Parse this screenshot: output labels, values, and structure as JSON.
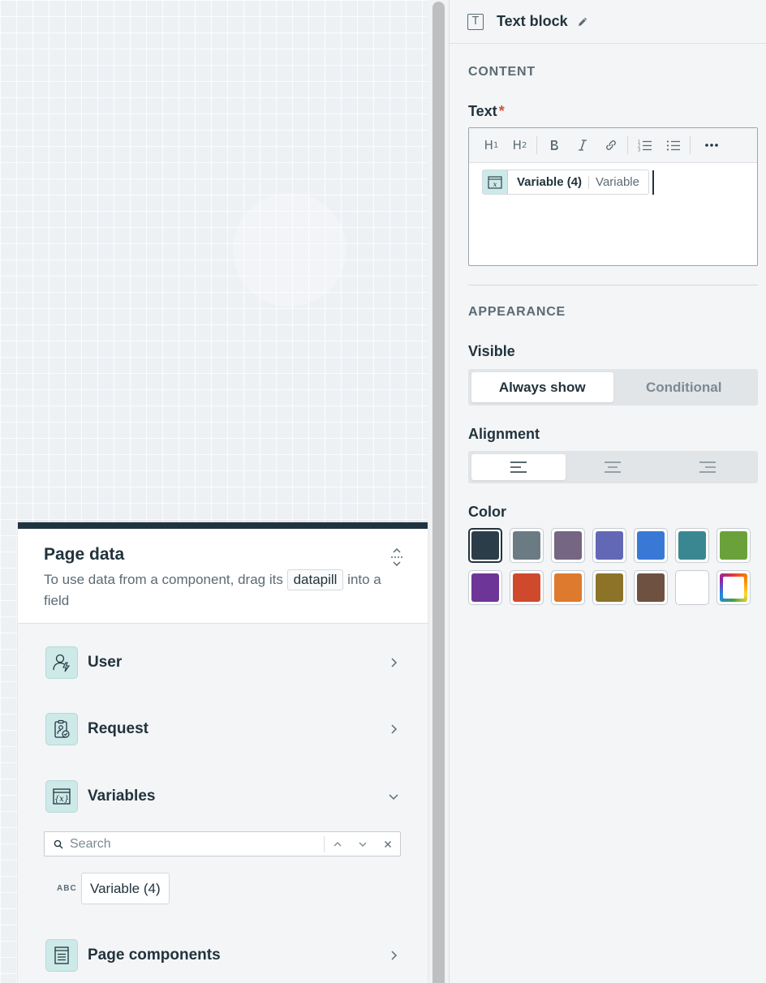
{
  "canvas": {},
  "page_data": {
    "title": "Page data",
    "description_before": "To use data from a component, drag its",
    "description_pill": "datapill",
    "description_after": "into a field",
    "sections": [
      {
        "label": "User",
        "icon": "user-icon",
        "expanded": false
      },
      {
        "label": "Request",
        "icon": "request-icon",
        "expanded": false
      },
      {
        "label": "Variables",
        "icon": "variables-icon",
        "expanded": true
      },
      {
        "label": "Page components",
        "icon": "page-components-icon",
        "expanded": false
      }
    ],
    "search": {
      "placeholder": "Search",
      "value": ""
    },
    "variables": [
      {
        "type_tag": "ABC",
        "name": "Variable (4)"
      }
    ]
  },
  "properties": {
    "title": "Text block",
    "content_heading": "CONTENT",
    "text_label": "Text",
    "required_mark": "*",
    "toolbar": [
      "H1",
      "H2",
      "bold",
      "italic",
      "link",
      "ordered-list",
      "bulleted-list",
      "more"
    ],
    "editor": {
      "datapill_label": "Variable (4)",
      "datapill_type": "Variable"
    },
    "appearance_heading": "APPEARANCE",
    "visible_label": "Visible",
    "visible_options": [
      "Always show",
      "Conditional"
    ],
    "visible_selected": "Always show",
    "alignment_label": "Alignment",
    "alignment_options": [
      "left",
      "center",
      "right"
    ],
    "alignment_selected": "left",
    "color_label": "Color",
    "colors": [
      "#2b3d48",
      "#6b7b84",
      "#756683",
      "#6268b5",
      "#3a78d6",
      "#3b8791",
      "#6ba13a",
      "#6e3598",
      "#cf4a2c",
      "#dd7a2e",
      "#8c7328",
      "#6e5140",
      "#ffffff",
      "custom"
    ],
    "color_selected": "#2b3d48"
  }
}
